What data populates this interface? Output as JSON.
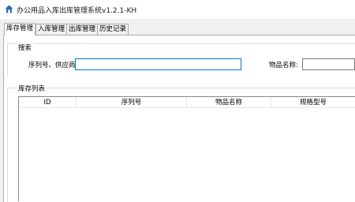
{
  "window": {
    "title": "办公用品入库出库管理系统v1.2.1-KH",
    "icon": "app-home-icon"
  },
  "tabs": [
    {
      "label": "库存管理",
      "active": true
    },
    {
      "label": "入库管理",
      "active": false
    },
    {
      "label": "出库管理",
      "active": false
    },
    {
      "label": "历史记录",
      "active": false
    }
  ],
  "search": {
    "group_title": "搜索",
    "serial_supplier_label": "序列号、供应商:",
    "serial_supplier_value": "",
    "item_name_label": "物品名称:",
    "item_name_value": ""
  },
  "inventory": {
    "group_title": "库存列表",
    "columns": [
      "ID",
      "序列号",
      "物品名称",
      "规格型号"
    ],
    "rows": []
  },
  "colors": {
    "focus_border": "#0078d7",
    "tab_border": "#adadad"
  }
}
